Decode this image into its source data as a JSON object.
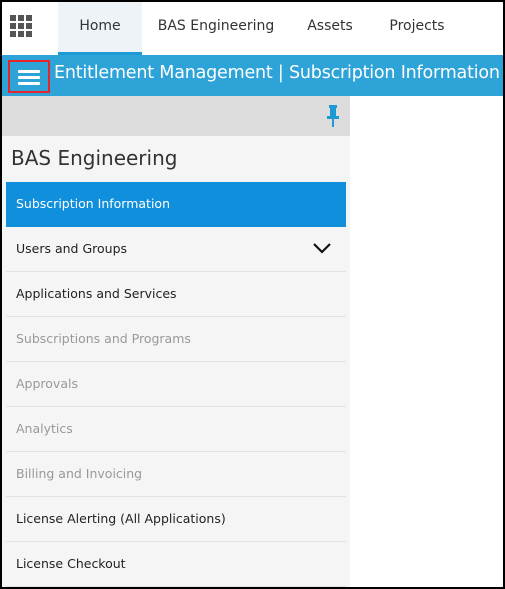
{
  "topnav": {
    "tabs": [
      {
        "label": "Home",
        "active": true
      },
      {
        "label": "BAS Engineering",
        "active": false
      },
      {
        "label": "Assets",
        "active": false
      },
      {
        "label": "Projects",
        "active": false
      }
    ]
  },
  "titlebar": {
    "title": "Entitlement Management | Subscription Information"
  },
  "panel": {
    "title": "BAS Engineering",
    "items": [
      {
        "label": "Subscription Information",
        "state": "active"
      },
      {
        "label": "Users and Groups",
        "state": "normal",
        "expandable": true
      },
      {
        "label": "Applications and Services",
        "state": "normal"
      },
      {
        "label": "Subscriptions and Programs",
        "state": "disabled"
      },
      {
        "label": "Approvals",
        "state": "disabled"
      },
      {
        "label": "Analytics",
        "state": "disabled"
      },
      {
        "label": "Billing and Invoicing",
        "state": "disabled"
      },
      {
        "label": "License Alerting (All Applications)",
        "state": "normal"
      },
      {
        "label": "License Checkout",
        "state": "normal"
      }
    ]
  },
  "icons": {
    "apps": "app-grid-icon",
    "menu": "hamburger-menu-icon",
    "pin": "pin-icon",
    "expand": "chevron-down-icon"
  },
  "colors": {
    "accent": "#2ea3d8",
    "active_item": "#0f8fdc",
    "highlight_border": "#e5252a"
  }
}
